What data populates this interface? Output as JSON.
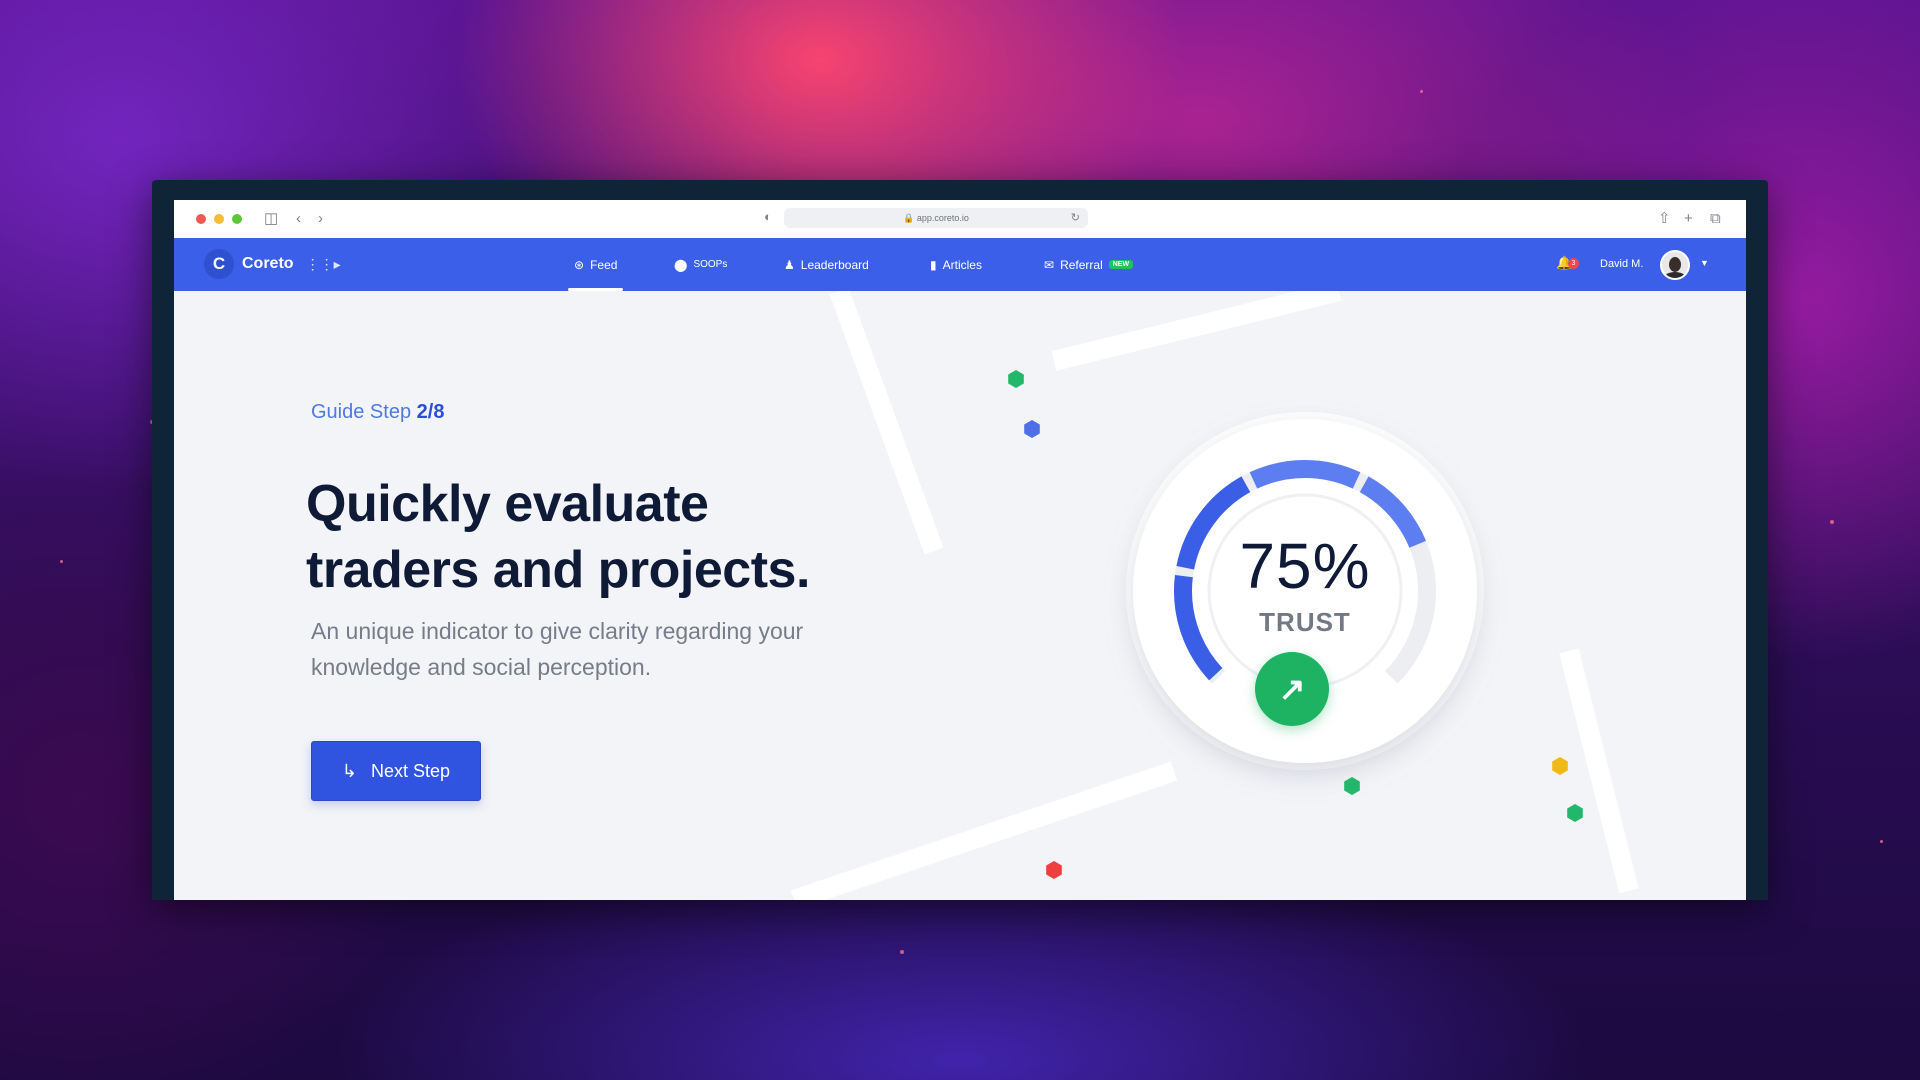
{
  "browser": {
    "url": "app.coreto.io",
    "traffic_lights": [
      "#ee5a52",
      "#f5bd2f",
      "#5fc53a"
    ]
  },
  "nav": {
    "brand": "Coreto",
    "items": [
      {
        "label": "Feed",
        "icon": "rss-icon",
        "active": true
      },
      {
        "label": "SOOPs",
        "icon": "toggle-icon",
        "active": false
      },
      {
        "label": "Leaderboard",
        "icon": "user-icon",
        "active": false
      },
      {
        "label": "Articles",
        "icon": "book-icon",
        "active": false
      },
      {
        "label": "Referral",
        "icon": "chat-icon",
        "active": false,
        "badge": "NEW"
      }
    ],
    "notifications_count": "3",
    "user_name": "David M."
  },
  "guide": {
    "step_label": "Guide Step",
    "step_value": "2/8",
    "headline_line1": "Quickly evaluate",
    "headline_line2": "traders and projects.",
    "subtitle": "An unique indicator to give clarity regarding your knowledge and social perception.",
    "button_label": "Next Step"
  },
  "gauge": {
    "percent_text": "75%",
    "label": "TRUST",
    "value": 0.75
  },
  "colors": {
    "accent": "#3b5fe8",
    "button": "#3054e0",
    "success": "#1db363",
    "headline": "#0e1a36",
    "dots": [
      "#22b76a",
      "#4f6fe6",
      "#f0b918",
      "#ee3f3f"
    ]
  }
}
